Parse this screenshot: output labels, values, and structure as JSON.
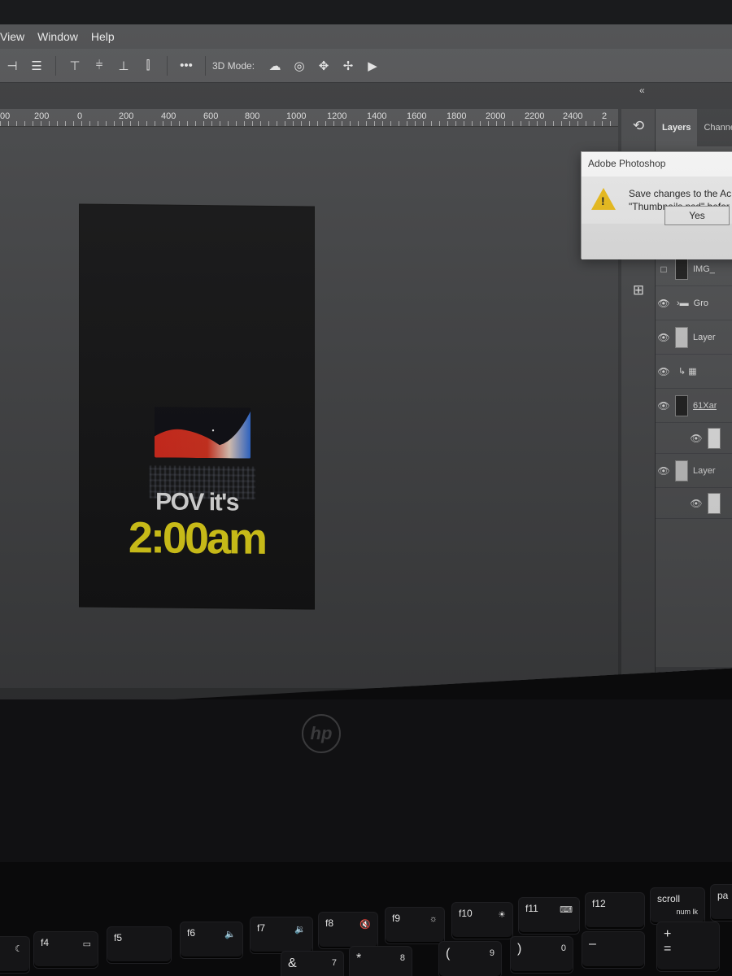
{
  "menu": {
    "items": [
      "View",
      "Window",
      "Help"
    ]
  },
  "options_bar": {
    "mode_label": "3D Mode:",
    "align_icons": [
      "align-left-edges-icon",
      "align-vertical-centers-icon",
      "align-top-icon",
      "align-horizontal-centers-icon",
      "align-bottom-icon",
      "distribute-icon"
    ],
    "more_label": "•••",
    "mode_icons": [
      "orbit-icon",
      "roll-icon",
      "pan-icon",
      "slide-icon",
      "video-camera-icon"
    ]
  },
  "ruler": {
    "labels": [
      "00",
      "200",
      "0",
      "200",
      "400",
      "600",
      "800",
      "1000",
      "1200",
      "1400",
      "1600",
      "1800",
      "2000",
      "2200",
      "2400",
      "2"
    ]
  },
  "artboard": {
    "pov_text": "POV it's",
    "time_text": "2:00am",
    "text_color": "#f4e41a"
  },
  "panel": {
    "collapse_label": "«",
    "tabs": [
      "Layers",
      "Channe"
    ],
    "strip_icons": [
      "history-icon",
      "adjustments-icon",
      "properties-icon"
    ],
    "layers": [
      {
        "name": "IMG_",
        "thumb": "dark",
        "visible": false
      },
      {
        "name": "Gro",
        "thumb": "folder",
        "visible": true
      },
      {
        "name": "Layer",
        "thumb": "light",
        "visible": true
      },
      {
        "name": "",
        "thumb": "adjust",
        "visible": true
      },
      {
        "name": "61Xar",
        "thumb": "dark",
        "visible": true,
        "link": true
      },
      {
        "name": "",
        "thumb": "white",
        "visible": true,
        "sub": true
      },
      {
        "name": "Layer",
        "thumb": "light",
        "visible": true
      },
      {
        "name": "",
        "thumb": "white",
        "visible": true,
        "sub": true
      }
    ],
    "footer_icons": [
      "link-icon",
      "fx-icon"
    ],
    "footer_fx": "fx"
  },
  "dialog": {
    "title": "Adobe Photoshop",
    "message_line1": "Save changes to the Ac",
    "message_line2": "\"Thumbnails.psd\" befor",
    "yes_label": "Yes",
    "warning_color": "#f2c21b"
  },
  "laptop": {
    "logo": "hp"
  },
  "keyboard": {
    "keys": [
      {
        "label": "",
        "glyph": "☾"
      },
      {
        "label": "f4",
        "glyph": "▭"
      },
      {
        "label": "f5",
        "glyph": ""
      },
      {
        "label": "f6",
        "glyph": "🔈"
      },
      {
        "label": "f7",
        "glyph": "🔉"
      },
      {
        "label": "f8",
        "glyph": "🔇"
      },
      {
        "label": "f9",
        "glyph": "☼"
      },
      {
        "label": "f10",
        "glyph": "☀"
      },
      {
        "label": "f11",
        "glyph": "⌨"
      },
      {
        "label": "f12",
        "glyph": ""
      },
      {
        "label": "scroll",
        "glyph": "num lk"
      },
      {
        "label": "pa",
        "glyph": ""
      }
    ],
    "number_row": [
      "&",
      "7",
      "*",
      "8",
      "(",
      "9",
      ")",
      "0",
      "–",
      "+",
      "="
    ]
  }
}
